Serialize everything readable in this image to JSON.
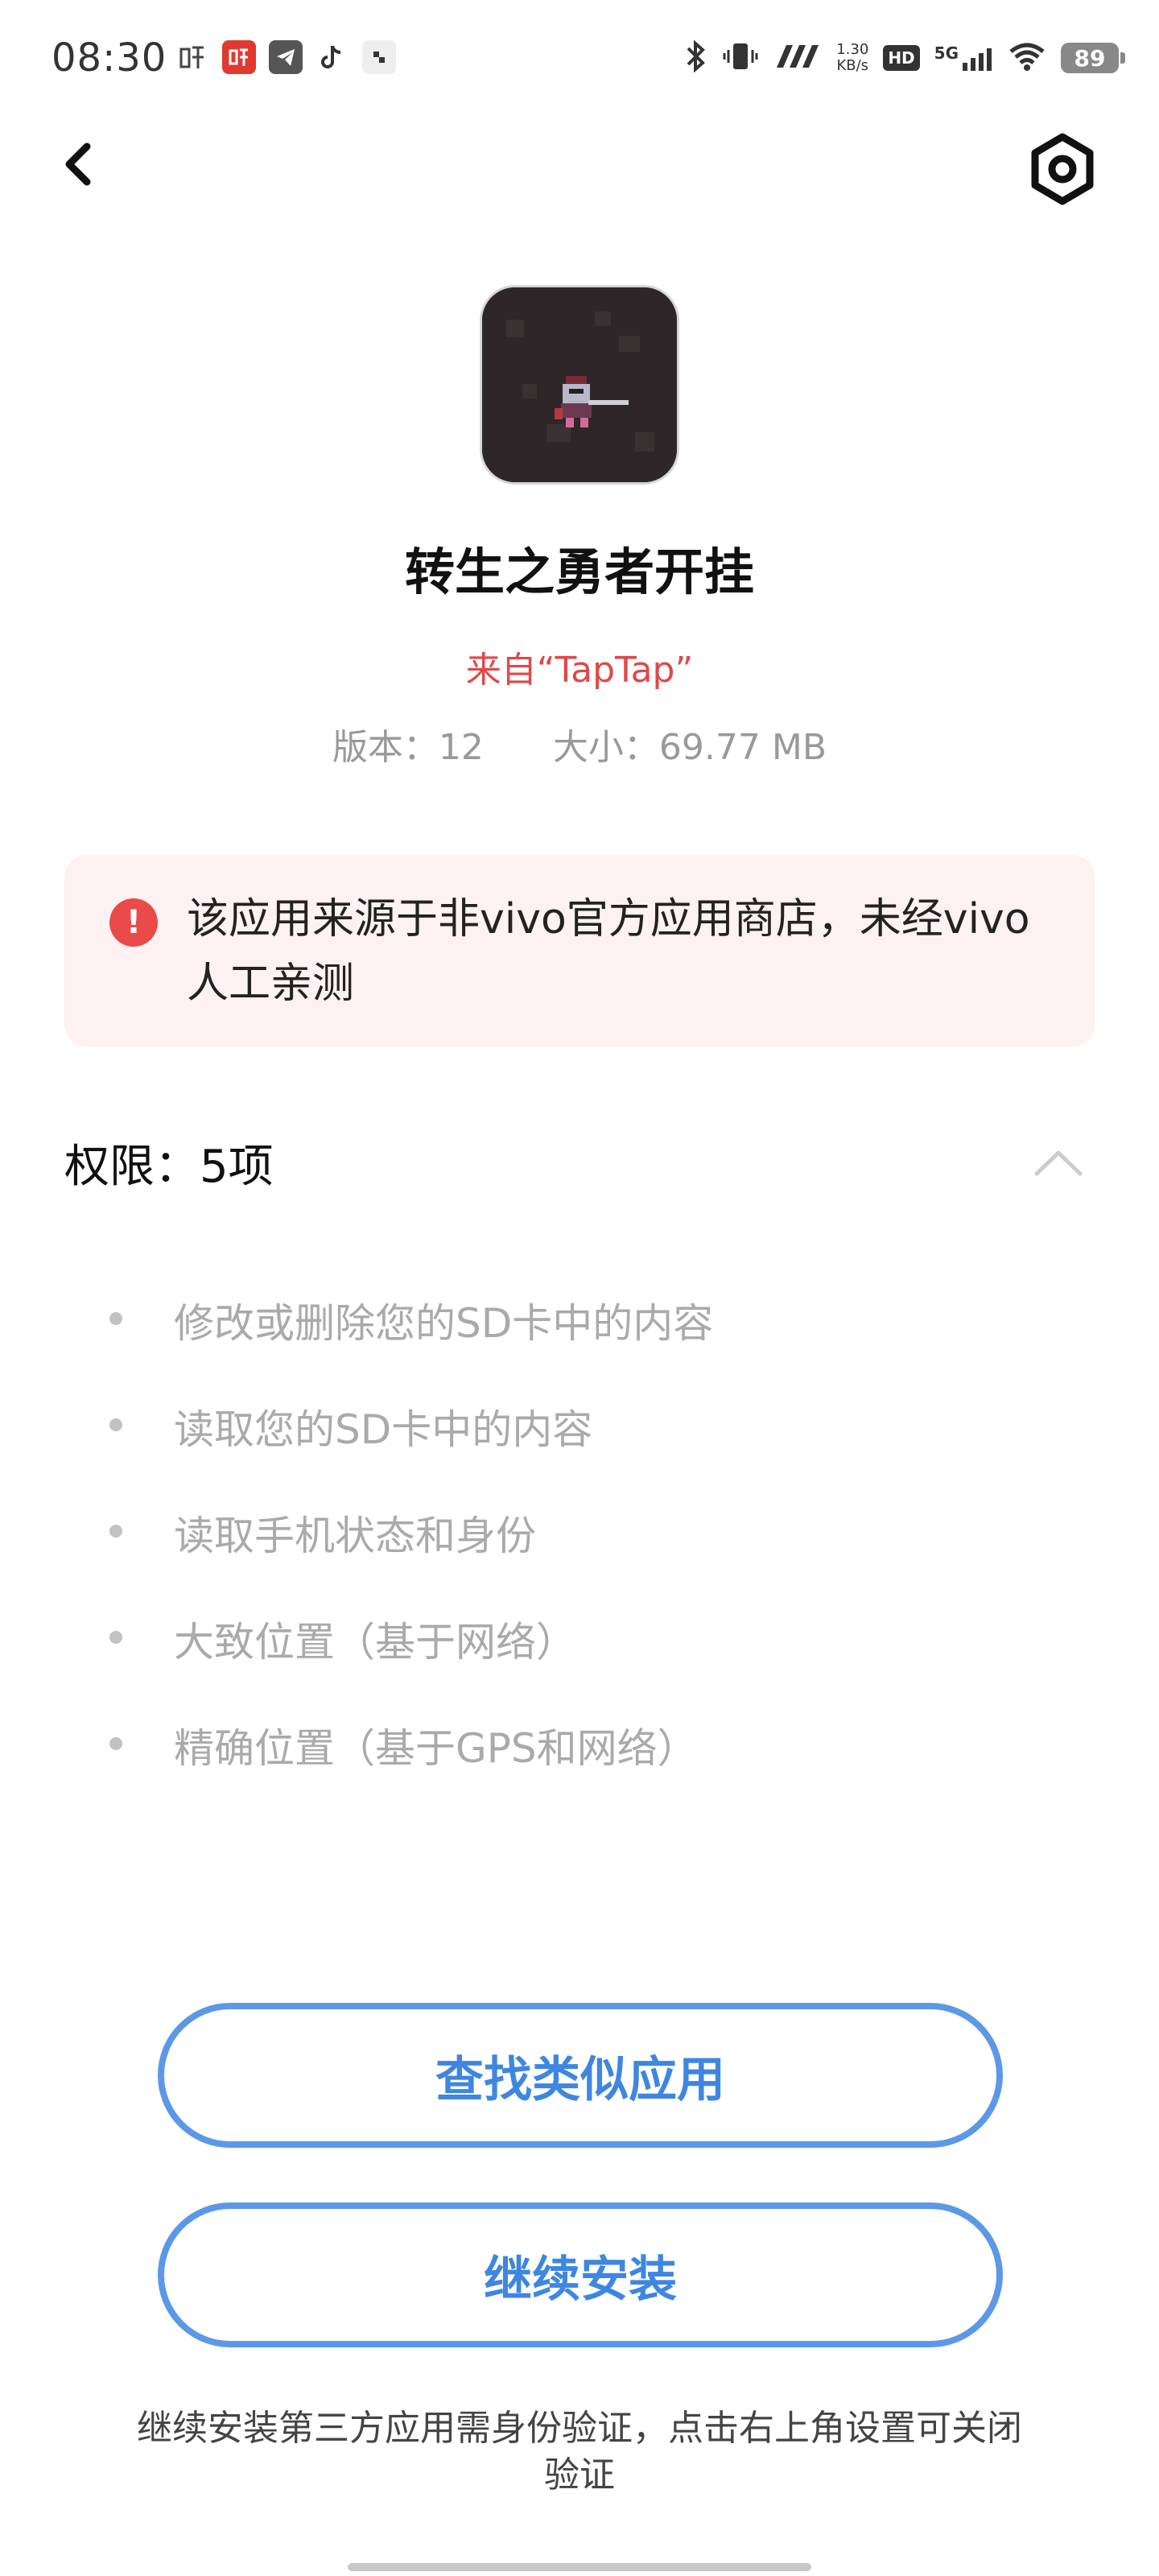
{
  "status_bar": {
    "time": "08:30",
    "notification_icons": [
      "ting-icon",
      "ting-red-icon",
      "telegram-icon",
      "tiktok-icon",
      "app-small-icon"
    ],
    "net_speed_value": "1.30",
    "net_speed_unit": "KB/s",
    "hd_label": "HD",
    "network_label": "5G",
    "battery": "89"
  },
  "header": {
    "back_icon": "chevron-left-icon",
    "settings_icon": "hexagon-settings-icon"
  },
  "app": {
    "name": "转生之勇者开挂",
    "source": "来自“TapTap”",
    "version": "版本：12",
    "size": "大小：69.77 MB"
  },
  "warning": {
    "text": "该应用来源于非vivo官方应用商店，未经vivo人工亲测",
    "icon": "exclamation-icon",
    "color": "#ea4a4a"
  },
  "permissions": {
    "header": "权限：5项",
    "items": [
      "修改或删除您的SD卡中的内容",
      "读取您的SD卡中的内容",
      "读取手机状态和身份",
      "大致位置（基于网络）",
      "精确位置（基于GPS和网络）"
    ]
  },
  "buttons": {
    "find_similar": "查找类似应用",
    "continue_install": "继续安装"
  },
  "footer_note": "继续安装第三方应用需身份验证，点击右上角设置可关闭验证",
  "colors": {
    "accent": "#3f86e0",
    "warning_bg": "#fdf1f1",
    "source_red": "#e04848"
  }
}
